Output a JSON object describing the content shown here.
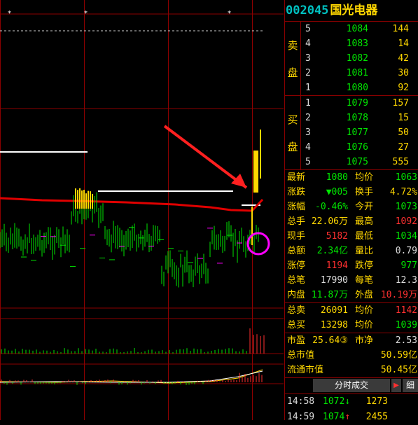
{
  "stock": {
    "code": "002045",
    "name": "国光电器"
  },
  "order_book": {
    "sell_label": "卖 盘",
    "buy_label": "买 盘",
    "asks": [
      {
        "level": "5",
        "price": "1084",
        "volume": "144"
      },
      {
        "level": "4",
        "price": "1083",
        "volume": "14"
      },
      {
        "level": "3",
        "price": "1082",
        "volume": "42"
      },
      {
        "level": "2",
        "price": "1081",
        "volume": "30"
      },
      {
        "level": "1",
        "price": "1080",
        "volume": "92"
      }
    ],
    "bids": [
      {
        "level": "1",
        "price": "1079",
        "volume": "157"
      },
      {
        "level": "2",
        "price": "1078",
        "volume": "15"
      },
      {
        "level": "3",
        "price": "1077",
        "volume": "50"
      },
      {
        "level": "4",
        "price": "1076",
        "volume": "27"
      },
      {
        "level": "5",
        "price": "1075",
        "volume": "555"
      }
    ]
  },
  "quote": {
    "latest_label": "最新",
    "latest": "1080",
    "avg_label": "均价",
    "avg": "1063",
    "change_label": "涨跌",
    "change": "▼005",
    "turnover_label": "换手",
    "turnover": "4.72%",
    "pct_label": "涨幅",
    "pct": "-0.46%",
    "open_label": "今开",
    "open": "1073",
    "vol_label": "总手",
    "vol": "22.06万",
    "high_label": "最高",
    "high": "1092",
    "cur_label": "现手",
    "cur": "5182",
    "low_label": "最低",
    "low": "1034",
    "amount_label": "总额",
    "amount": "2.34亿",
    "ratio_label": "量比",
    "ratio": "0.79",
    "limit_up_label": "涨停",
    "limit_up": "1194",
    "limit_down_label": "跌停",
    "limit_down": "977",
    "trades_label": "总笔",
    "trades": "17990",
    "per_trade_label": "每笔",
    "per_trade": "12.3",
    "inner_label": "内盘",
    "inner": "11.87万",
    "outer_label": "外盘",
    "outer": "10.19万",
    "total_sell_label": "总卖",
    "total_sell": "26091",
    "sell_avg_label": "均价",
    "sell_avg": "1142",
    "total_buy_label": "总买",
    "total_buy": "13298",
    "buy_avg_label": "均价",
    "buy_avg": "1039",
    "pe_label": "市盈",
    "pe": "25.64③",
    "nav_label": "市净",
    "nav": "2.53",
    "mktcap_label": "总市值",
    "mktcap": "50.59亿",
    "float_label": "流通市值",
    "float_cap": "50.45亿"
  },
  "trade_tab": {
    "label": "分时成交",
    "more": "细",
    "arrow": "▶"
  },
  "trades_list": [
    {
      "time": "14:58",
      "price": "1072",
      "dir": "down",
      "vol": "1273"
    },
    {
      "time": "14:59",
      "price": "1074",
      "dir": "up",
      "vol": "2455"
    }
  ],
  "colors": {
    "up": "#ff3030",
    "down": "#00e600",
    "label": "#ffd700",
    "grid": "#8b0000"
  }
}
